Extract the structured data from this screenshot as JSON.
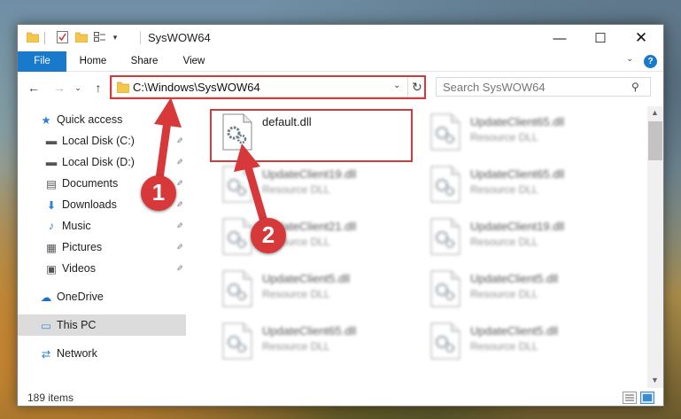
{
  "window": {
    "title": "SysWOW64",
    "controls": {
      "minimize": "—",
      "maximize": "☐",
      "close": "✕"
    }
  },
  "quick_access_toolbar": {
    "dropdown": "▾"
  },
  "ribbon": {
    "tabs": [
      "File",
      "Home",
      "Share",
      "View"
    ],
    "expand": "⌄",
    "help": "?"
  },
  "nav": {
    "back": "←",
    "forward": "→",
    "recent": "⌄",
    "up": "↑"
  },
  "address": {
    "path": "C:\\Windows\\SysWOW64",
    "dropdown": "⌄",
    "refresh": "↻"
  },
  "search": {
    "placeholder": "Search SysWOW64",
    "icon": "⚲"
  },
  "sidebar": {
    "items": [
      {
        "label": "Quick access",
        "icon": "star-icon",
        "glyph": "★",
        "pinned": false
      },
      {
        "label": "Local Disk (C:)",
        "icon": "drive-icon",
        "glyph": "▬",
        "pinned": true
      },
      {
        "label": "Local Disk (D:)",
        "icon": "drive-icon",
        "glyph": "▬",
        "pinned": true
      },
      {
        "label": "Documents",
        "icon": "documents-icon",
        "glyph": "▤",
        "pinned": true
      },
      {
        "label": "Downloads",
        "icon": "download-icon",
        "glyph": "⬇",
        "pinned": true
      },
      {
        "label": "Music",
        "icon": "music-icon",
        "glyph": "♪",
        "pinned": true
      },
      {
        "label": "Pictures",
        "icon": "pictures-icon",
        "glyph": "▦",
        "pinned": true
      },
      {
        "label": "Videos",
        "icon": "videos-icon",
        "glyph": "▣",
        "pinned": true
      },
      {
        "label": "OneDrive",
        "icon": "cloud-icon",
        "glyph": "☁",
        "pinned": false
      },
      {
        "label": "This PC",
        "icon": "computer-icon",
        "glyph": "▭",
        "pinned": false,
        "selected": true
      },
      {
        "label": "Network",
        "icon": "network-icon",
        "glyph": "⇄",
        "pinned": false
      }
    ],
    "pin_glyph": "📌"
  },
  "files": [
    {
      "name": "default.dll",
      "type": "",
      "blurred": false
    },
    {
      "name": "UpdateClient65.dll",
      "type": "Resource DLL",
      "blurred": true
    },
    {
      "name": "UpdateClient19.dll",
      "type": "Resource DLL",
      "blurred": true
    },
    {
      "name": "UpdateClient65.dll",
      "type": "Resource DLL",
      "blurred": true
    },
    {
      "name": "UpdateClient21.dll",
      "type": "Resource DLL",
      "blurred": true
    },
    {
      "name": "UpdateClient19.dll",
      "type": "Resource DLL",
      "blurred": true
    },
    {
      "name": "UpdateClient5.dll",
      "type": "Resource DLL",
      "blurred": true
    },
    {
      "name": "UpdateClient5.dll",
      "type": "Resource DLL",
      "blurred": true
    },
    {
      "name": "UpdateClient65.dll",
      "type": "Resource DLL",
      "blurred": true
    },
    {
      "name": "UpdateClient5.dll",
      "type": "Resource DLL",
      "blurred": true
    }
  ],
  "status": {
    "item_count": "189 items"
  },
  "callouts": [
    "1",
    "2"
  ],
  "colors": {
    "accent": "#1979ca",
    "highlight": "#d4393b",
    "selected_bg": "#dcdcdc"
  }
}
